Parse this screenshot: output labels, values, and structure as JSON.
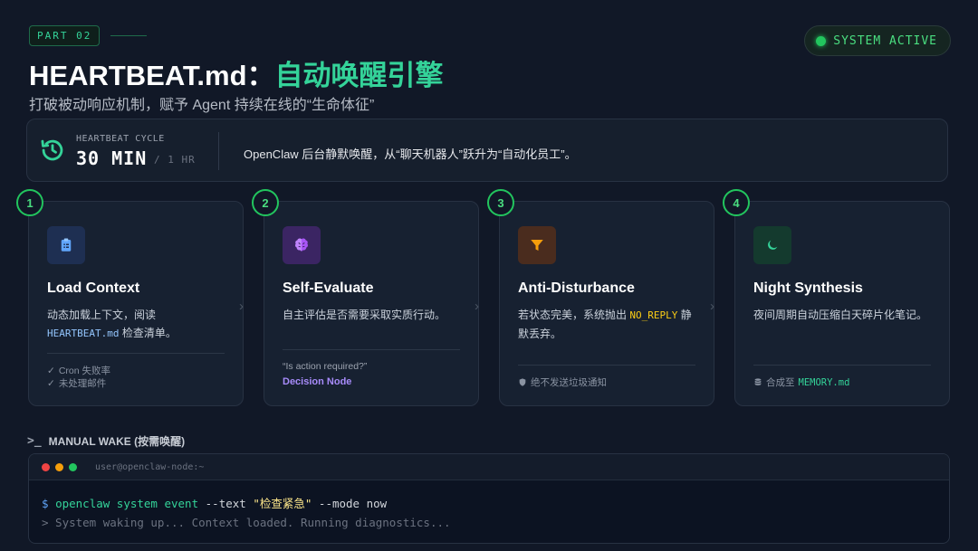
{
  "header": {
    "part_tag": "PART 02",
    "status": "SYSTEM ACTIVE",
    "title_main": "HEARTBEAT.md：",
    "title_accent": "自动唤醒引擎",
    "subtitle": "打破被动响应机制，赋予 Agent 持续在线的“生命体征”"
  },
  "heartbeat": {
    "label": "HEARTBEAT CYCLE",
    "value": "30 MIN",
    "alt": "/ 1 HR",
    "description": "OpenClaw 后台静默唤醒，从“聊天机器人”跃升为“自动化员工”。"
  },
  "cards": [
    {
      "num": "1",
      "icon": "clipboard-icon",
      "title": "Load Context",
      "desc_a": "动态加载上下文，阅读",
      "desc_code": "HEARTBEAT.md",
      "desc_b": " 检查清单。",
      "foot": [
        "Cron 失败率",
        "未处理邮件"
      ]
    },
    {
      "num": "2",
      "icon": "brain-icon",
      "title": "Self-Evaluate",
      "desc": "自主评估是否需要采取实质行动。",
      "quote": "“Is action required?”",
      "node": "Decision Node"
    },
    {
      "num": "3",
      "icon": "filter-icon",
      "title": "Anti-Disturbance",
      "desc_a": "若状态完美，系统抛出 ",
      "desc_code": "NO_REPLY",
      "desc_b": " 静默丢弃。",
      "foot": "绝不发送垃圾通知"
    },
    {
      "num": "4",
      "icon": "moon-icon",
      "title": "Night Synthesis",
      "desc": "夜间周期自动压缩白天碎片化笔记。",
      "foot_a": "合成至 ",
      "foot_code": "MEMORY.md"
    }
  ],
  "manual_wake": {
    "label": "MANUAL WAKE (按需唤醒)",
    "host": "user@openclaw-node:~",
    "prompt": "$",
    "cmd": "openclaw system event",
    "flag_text": "--text",
    "arg_text": "\"检查紧急\"",
    "flag_mode": "--mode",
    "arg_mode": "now",
    "output": "> System waking up... Context loaded. Running diagnostics..."
  },
  "colors": {
    "accent": "#34d399",
    "background": "#111827",
    "card": "#172131"
  }
}
